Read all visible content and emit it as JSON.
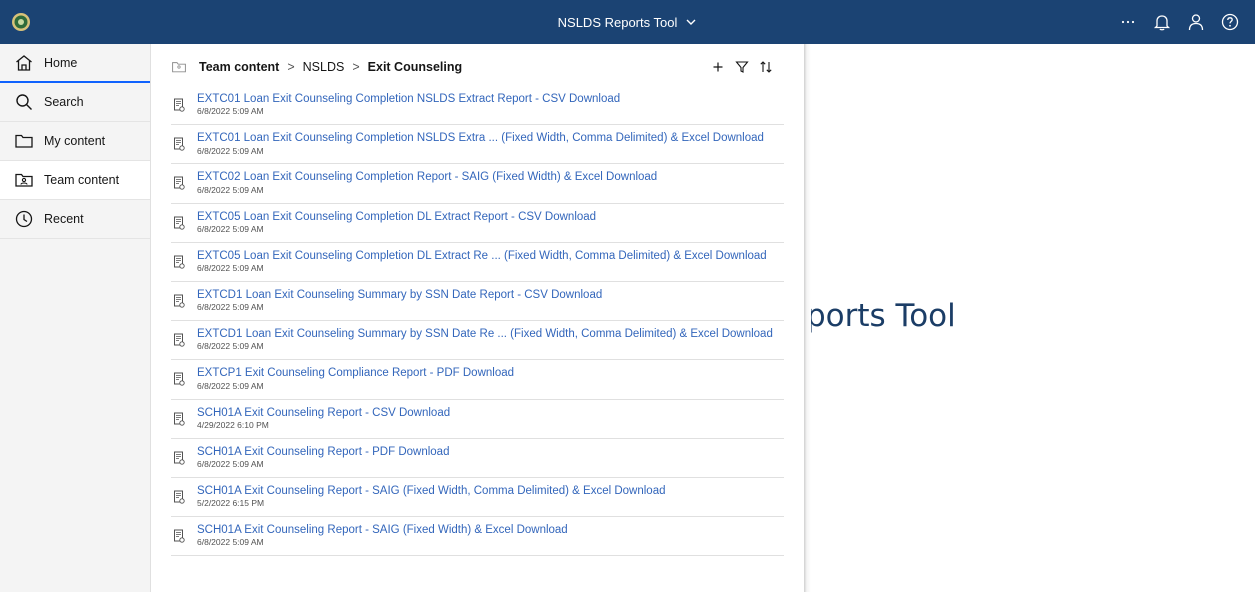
{
  "topbar": {
    "app_title": "NSLDS Reports Tool",
    "icons": [
      "more-icon",
      "bell-icon",
      "user-icon",
      "help-icon"
    ],
    "background": "#1b4373"
  },
  "nav": {
    "items": [
      {
        "label": "Home",
        "icon": "home-icon"
      },
      {
        "label": "Search",
        "icon": "search-icon"
      },
      {
        "label": "My content",
        "icon": "folder-icon"
      },
      {
        "label": "Team content",
        "icon": "team-folder-icon",
        "active": true
      },
      {
        "label": "Recent",
        "icon": "clock-icon"
      }
    ]
  },
  "breadcrumb": {
    "root": "Team content",
    "middle": "NSLDS",
    "current": "Exit Counseling"
  },
  "items": [
    {
      "title": "EXTC01 Loan Exit Counseling Completion NSLDS Extract Report - CSV Download",
      "date": "6/8/2022 5:09 AM"
    },
    {
      "title": "EXTC01 Loan Exit Counseling Completion NSLDS Extra ... (Fixed Width, Comma Delimited) & Excel Download",
      "date": "6/8/2022 5:09 AM"
    },
    {
      "title": "EXTC02 Loan Exit Counseling Completion Report - SAIG (Fixed Width) & Excel Download",
      "date": "6/8/2022 5:09 AM"
    },
    {
      "title": "EXTC05 Loan Exit Counseling Completion DL Extract Report - CSV Download",
      "date": "6/8/2022 5:09 AM"
    },
    {
      "title": "EXTC05 Loan Exit Counseling Completion DL Extract Re ... (Fixed Width, Comma Delimited) & Excel Download",
      "date": "6/8/2022 5:09 AM"
    },
    {
      "title": "EXTCD1 Loan Exit Counseling Summary by SSN Date Report - CSV Download",
      "date": "6/8/2022 5:09 AM"
    },
    {
      "title": "EXTCD1 Loan Exit Counseling Summary by SSN Date Re ... (Fixed Width, Comma Delimited) & Excel Download",
      "date": "6/8/2022 5:09 AM"
    },
    {
      "title": "EXTCP1 Exit Counseling Compliance Report - PDF Download",
      "date": "6/8/2022 5:09 AM"
    },
    {
      "title": "SCH01A Exit Counseling Report - CSV Download",
      "date": "4/29/2022 6:10 PM"
    },
    {
      "title": "SCH01A Exit Counseling Report - PDF Download",
      "date": "6/8/2022 5:09 AM"
    },
    {
      "title": "SCH01A Exit Counseling Report - SAIG (Fixed Width, Comma Delimited) & Excel Download",
      "date": "5/2/2022 6:15 PM"
    },
    {
      "title": "SCH01A Exit Counseling Report - SAIG (Fixed Width) & Excel Download",
      "date": "6/8/2022 5:09 AM"
    }
  ],
  "background": {
    "title_fragment": "ports Tool"
  }
}
